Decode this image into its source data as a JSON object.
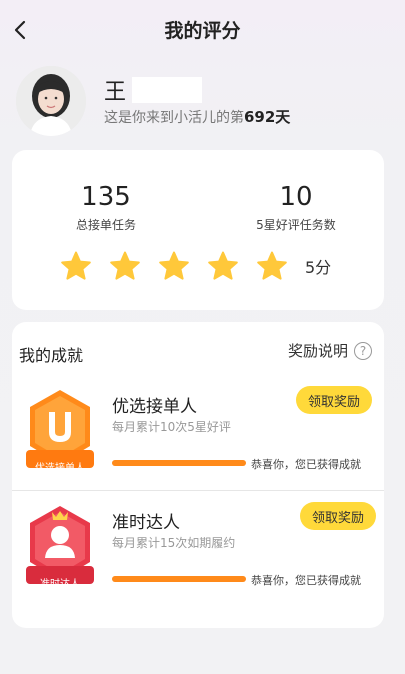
{
  "header": {
    "title": "我的评分"
  },
  "profile": {
    "name": "王",
    "days_prefix": "这是你来到小活儿的第",
    "days_value": "692天"
  },
  "stats": {
    "total_tasks": "135",
    "total_tasks_label": "总接单任务",
    "five_star_tasks": "10",
    "five_star_tasks_label": "5星好评任务数",
    "rating": 5,
    "score_text": "5分"
  },
  "achievements": {
    "title": "我的成就",
    "info_label": "奖励说明",
    "items": [
      {
        "name": "优选接单人",
        "desc": "每月累计10次5星好评",
        "badge_label": "优选接单人",
        "progress": 1.0,
        "status": "恭喜你，您已获得成就",
        "button": "领取奖励"
      },
      {
        "name": "准时达人",
        "desc": "每月累计15次如期履约",
        "badge_label": "准时达人",
        "progress": 1.0,
        "status": "恭喜你，您已获得成就",
        "button": "领取奖励"
      }
    ]
  },
  "colors": {
    "accent_yellow": "#ffd93a",
    "progress_orange": "#ff8a1a",
    "star_yellow": "#ffc83a"
  }
}
